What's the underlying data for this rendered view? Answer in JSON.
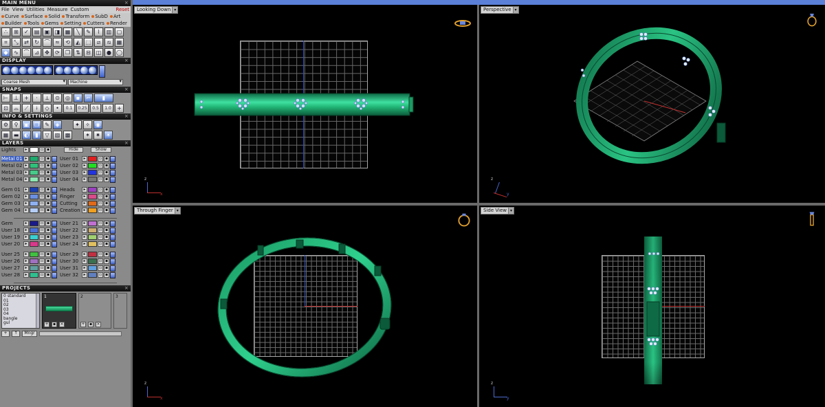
{
  "app": {
    "accent_color": "#3b5fc0",
    "header_color": "#111111",
    "ring_color": "#1faa6e"
  },
  "main_menu": {
    "title": "MAIN MENU",
    "menus": [
      "File",
      "View",
      "Utilities",
      "Measure",
      "Custom"
    ],
    "reset_label": "Reset",
    "categories_row1": [
      "Curve",
      "Surface",
      "Solid",
      "Transform",
      "SubD",
      "Art"
    ],
    "categories_row2": [
      "Builder",
      "Tools",
      "Gems",
      "Setting",
      "Cutters",
      "Render"
    ]
  },
  "display": {
    "title": "DISPLAY",
    "mesh_select": "Coarse Mesh",
    "material_select": "Machine"
  },
  "snaps": {
    "title": "SNAPS",
    "values": [
      "0.1",
      "0.25",
      "0.5",
      "1.0"
    ]
  },
  "info": {
    "title": "INFO & SETTINGS"
  },
  "layers": {
    "title": "LAYERS",
    "lights_label": "Lights",
    "hide_label": "Hide",
    "show_label": "Show",
    "groups": [
      {
        "left": [
          {
            "name": "Metal 01",
            "color": "#1faa6e",
            "selected": true
          },
          {
            "name": "Metal 02",
            "color": "#2fbf7a"
          },
          {
            "name": "Metal 03",
            "color": "#48c98a"
          },
          {
            "name": "Metal 04",
            "color": "#8ee6b2"
          }
        ],
        "right": [
          {
            "name": "User 01",
            "color": "#e02020"
          },
          {
            "name": "User 02",
            "color": "#22dd22"
          },
          {
            "name": "User 03",
            "color": "#2233dd"
          },
          {
            "name": "User 04",
            "color": "#777777"
          }
        ]
      },
      {
        "left": [
          {
            "name": "Gem 01",
            "color": "#1a3fb0"
          },
          {
            "name": "Gem 02",
            "color": "#6b8fe0"
          },
          {
            "name": "Gem 03",
            "color": "#8fb0f0"
          },
          {
            "name": "Gem 04",
            "color": "#b5cdf5"
          }
        ],
        "right": [
          {
            "name": "Heads",
            "color": "#9a3fc0"
          },
          {
            "name": "Finger",
            "color": "#d84a8a"
          },
          {
            "name": "Cutting",
            "color": "#e06a1a"
          },
          {
            "name": "Creation",
            "color": "#f0a020"
          }
        ]
      },
      {
        "left": [
          {
            "name": "Gem",
            "color": "#1a1a8a"
          },
          {
            "name": "User 18",
            "color": "#4a70d8"
          },
          {
            "name": "User 19",
            "color": "#3ad0d0"
          },
          {
            "name": "User 20",
            "color": "#d83a8a"
          }
        ],
        "right": [
          {
            "name": "User 21",
            "color": "#c070d0"
          },
          {
            "name": "User 22",
            "color": "#d0b070"
          },
          {
            "name": "User 23",
            "color": "#a0d070"
          },
          {
            "name": "User 24",
            "color": "#e0c060"
          }
        ]
      },
      {
        "left": [
          {
            "name": "User 25",
            "color": "#40c040"
          },
          {
            "name": "User 26",
            "color": "#a070c0"
          },
          {
            "name": "User 27",
            "color": "#60a0a0"
          },
          {
            "name": "User 28",
            "color": "#30c090"
          }
        ],
        "right": [
          {
            "name": "User 29",
            "color": "#c03040"
          },
          {
            "name": "User 30",
            "color": "#3a7050"
          },
          {
            "name": "User 31",
            "color": "#60a0e0"
          },
          {
            "name": "User 32",
            "color": "#6080c0"
          }
        ]
      }
    ]
  },
  "projects": {
    "title": "PROJECTS",
    "items": [
      "0 standard",
      "01",
      "02",
      "03",
      "04",
      "bangle",
      "gul"
    ],
    "slots": [
      "1",
      "2",
      "3"
    ],
    "buttons": [
      "+",
      "↑",
      "Mngr"
    ]
  },
  "viewports": [
    {
      "label": "Looking Down"
    },
    {
      "label": "Perspective"
    },
    {
      "label": "Through Finger"
    },
    {
      "label": "Side View"
    }
  ],
  "axes": {
    "x": "x",
    "y": "y",
    "z": "z"
  }
}
